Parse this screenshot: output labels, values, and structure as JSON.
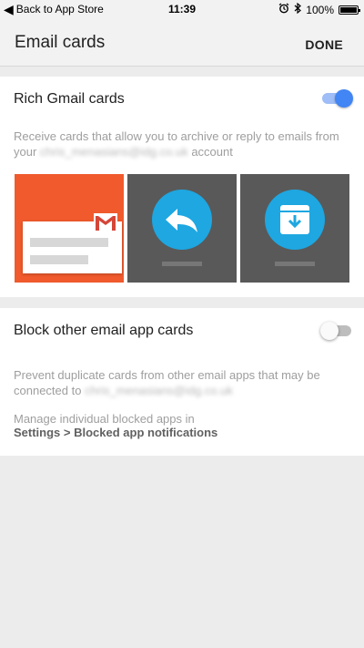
{
  "status_bar": {
    "back_label": "Back to App Store",
    "time": "11:39",
    "battery": "100%"
  },
  "app_bar": {
    "title": "Email cards",
    "done_label": "DONE"
  },
  "rich_cards": {
    "title": "Rich Gmail cards",
    "enabled": true,
    "desc_prefix": "Receive cards that allow you to archive or reply to emails from your",
    "account": "chris_menasians@idg.co.uk",
    "desc_suffix": "account",
    "previews": [
      {
        "name": "gmail-email-card"
      },
      {
        "name": "reply-card"
      },
      {
        "name": "archive-card"
      }
    ]
  },
  "block_cards": {
    "title": "Block other email app cards",
    "enabled": false,
    "desc_prefix": "Prevent duplicate cards from other email apps that may be connected to",
    "account": "chris_menasians@idg.co.uk",
    "manage_text": "Manage individual blocked apps in",
    "settings_path": "Settings > Blocked app notifications"
  },
  "colors": {
    "accent": "#4285f4",
    "gmail_orange": "#f05a2c",
    "card_gray": "#595959",
    "action_blue": "#1ea7e1"
  }
}
